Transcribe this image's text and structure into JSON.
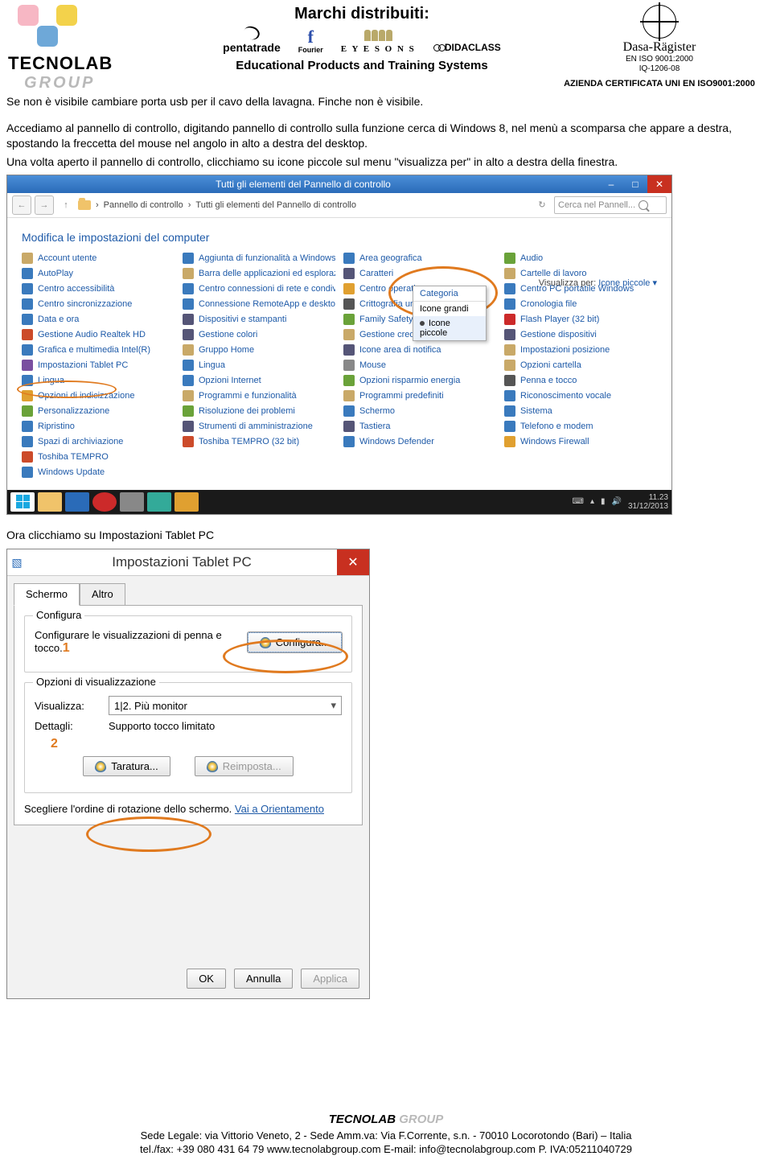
{
  "header": {
    "logo": {
      "line1": "TECNOLAB",
      "line2": "GROUP"
    },
    "marchi": "Marchi distribuiti:",
    "brands": {
      "pentatrade": "pentatrade",
      "fourier": "Fourier",
      "eyesons": "E Y E S O N S",
      "didaclass": "DIDACLASS"
    },
    "edu": "Educational Products and Training Systems",
    "dasa": "Dasa-Rägister",
    "iso1": "EN ISO 9001:2000",
    "iso2": "IQ-1206-08",
    "cert": "AZIENDA CERTIFICATA UNI EN ISO9001:2000"
  },
  "para1": "Se non è visibile cambiare porta usb per il cavo della lavagna. Finche non è visibile.",
  "para2": "Accediamo al pannello di controllo, digitando pannello di controllo sulla funzione cerca di Windows 8, nel menù a scomparsa che appare a destra, spostando la freccetta del mouse nel angolo in alto a destra del desktop.",
  "para3": "Una volta aperto il pannello di controllo, clicchiamo su icone piccole sul menu \"visualizza per\" in alto a destra della finestra.",
  "cp": {
    "title": "Tutti gli elementi del Pannello di controllo",
    "bc1": "Pannello di controllo",
    "bc_sep": "›",
    "bc2": "Tutti gli elementi del Pannello di controllo",
    "search": "Cerca nel Pannell...",
    "heading": "Modifica le impostazioni del computer",
    "viewby_label": "Visualizza per:",
    "viewby_value": "Icone piccole ▾",
    "dropdown": {
      "hdr": "Categoria",
      "o1": "Icone grandi",
      "o2": "Icone piccole"
    },
    "tray": {
      "time": "11.23",
      "date": "31/12/2013"
    },
    "cols": [
      [
        "Account utente",
        "AutoPlay",
        "Centro accessibilità",
        "Centro sincronizzazione",
        "Data e ora",
        "Gestione Audio Realtek HD",
        "Grafica e multimedia Intel(R)",
        "Impostazioni Tablet PC",
        "Lingua",
        "Opzioni di indicizzazione",
        "Personalizzazione",
        "Ripristino",
        "Spazi di archiviazione",
        "Toshiba TEMPRO",
        "Windows Update"
      ],
      [
        "Aggiunta di funzionalità a Windows ...",
        "Barra delle applicazioni ed esplorazio...",
        "Centro connessioni di rete e condivis...",
        "Connessione RemoteApp e desktop",
        "Dispositivi e stampanti",
        "Gestione colori",
        "Gruppo Home",
        "Lingua",
        "Opzioni Internet",
        "Programmi e funzionalità",
        "Risoluzione dei problemi",
        "Strumenti di amministrazione",
        "Toshiba TEMPRO (32 bit)"
      ],
      [
        "Area geografica",
        "Caratteri",
        "Centro operativo",
        "Crittografia unità BitLocker",
        "Family Safety",
        "Gestione credenziali",
        "Icone area di notifica",
        "Mouse",
        "Opzioni risparmio energia",
        "Programmi predefiniti",
        "Schermo",
        "Tastiera",
        "Windows Defender"
      ],
      [
        "Audio",
        "Cartelle di lavoro",
        "Centro PC portatile Windows",
        "Cronologia file",
        "Flash Player (32 bit)",
        "Gestione dispositivi",
        "Impostazioni posizione",
        "Opzioni cartella",
        "Penna e tocco",
        "Riconoscimento vocale",
        "Sistema",
        "Telefono e modem",
        "Windows Firewall"
      ]
    ],
    "icon_colors": [
      [
        "#c9a968",
        "#3a7abd",
        "#3a7abd",
        "#3a7abd",
        "#3a7abd",
        "#cc4b2a",
        "#3a7abd",
        "#7a4fa0",
        "#3a7abd",
        "#e0a030",
        "#6aa239",
        "#3a7abd",
        "#3a7abd",
        "#cc4b2a",
        "#3a7abd"
      ],
      [
        "#3a7abd",
        "#c9a968",
        "#3a7abd",
        "#3a7abd",
        "#557",
        "#557",
        "#c9a968",
        "#3a7abd",
        "#3a7abd",
        "#c9a968",
        "#6aa239",
        "#557",
        "#cc4b2a"
      ],
      [
        "#3a7abd",
        "#557",
        "#e0a030",
        "#555",
        "#6aa239",
        "#c9a968",
        "#557",
        "#888",
        "#6aa239",
        "#c9a968",
        "#3a7abd",
        "#557",
        "#3a7abd"
      ],
      [
        "#6aa239",
        "#c9a968",
        "#3a7abd",
        "#3a7abd",
        "#cc2a2a",
        "#557",
        "#c9a968",
        "#c9a968",
        "#555",
        "#3a7abd",
        "#3a7abd",
        "#3a7abd",
        "#e0a030"
      ]
    ]
  },
  "mid_text": "Ora clicchiamo su Impostazioni Tablet PC",
  "dlg": {
    "title": "Impostazioni Tablet PC",
    "tab1": "Schermo",
    "tab2": "Altro",
    "g1": "Configura",
    "g1_text": "Configurare le visualizzazioni di penna e tocco.",
    "badge1": "1",
    "btn_conf": "Configura...",
    "g2": "Opzioni di visualizzazione",
    "lbl_vis": "Visualizza:",
    "sel_vis": "1|2. Più monitor",
    "lbl_det": "Dettagli:",
    "val_det": "Supporto tocco limitato",
    "badge2": "2",
    "btn_tar": "Taratura...",
    "btn_reimp": "Reimposta...",
    "orient1": "Scegliere l'ordine di rotazione dello schermo. ",
    "orient2": "Vai a Orientamento",
    "ok": "OK",
    "cancel": "Annulla",
    "apply": "Applica"
  },
  "footer": {
    "brand": "TECNOLAB ",
    "brand2": "GROUP",
    "l1": "Sede Legale: via Vittorio Veneto, 2  -  Sede Amm.va: Via F.Corrente, s.n.  - 70010 Locorotondo (Bari) – Italia",
    "l2": "tel./fax: +39 080 431 64 79  www.tecnolabgroup.com  E-mail: info@tecnolabgroup.com  P. IVA:05211040729"
  }
}
